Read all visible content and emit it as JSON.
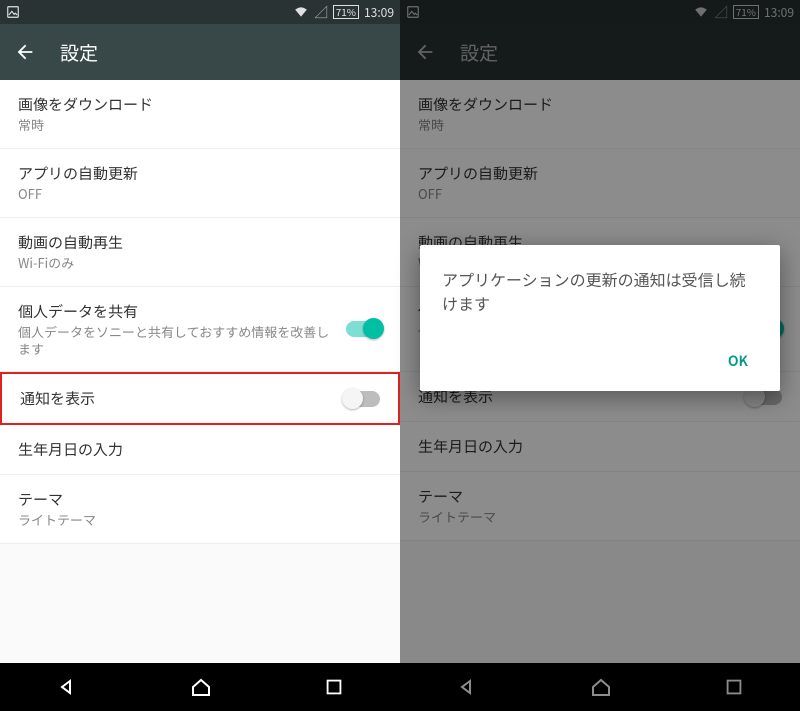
{
  "status": {
    "battery": "71%",
    "time": "13:09"
  },
  "appbar": {
    "title": "設定"
  },
  "items": [
    {
      "title": "画像をダウンロード",
      "sub": "常時"
    },
    {
      "title": "アプリの自動更新",
      "sub": "OFF"
    },
    {
      "title": "動画の自動再生",
      "sub": "Wi-Fiのみ"
    },
    {
      "title": "個人データを共有",
      "sub": "個人データをソニーと共有しておすすめ情報を改善します"
    },
    {
      "title": "通知を表示",
      "sub": ""
    },
    {
      "title": "生年月日の入力",
      "sub": ""
    },
    {
      "title": "テーマ",
      "sub": "ライトテーマ"
    }
  ],
  "dialog": {
    "text": "アプリケーションの更新の通知は受信し続けます",
    "ok": "OK"
  }
}
